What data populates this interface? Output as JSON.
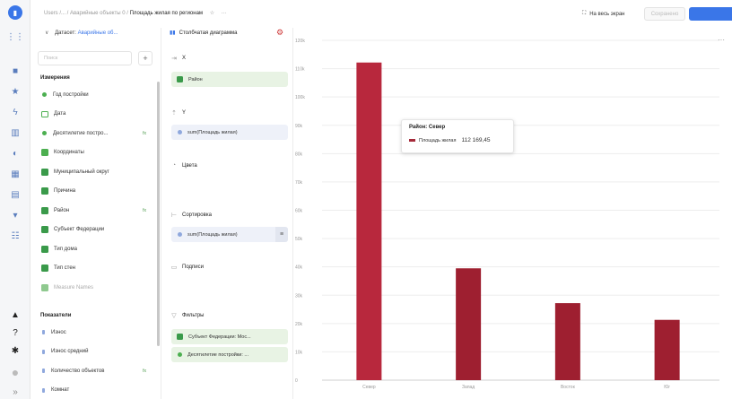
{
  "topbar": {
    "breadcrumb_prefix": "Users /... / Аварийные объекты 0 /",
    "breadcrumb_current": "Площадь жилая по регионам",
    "star": "☆",
    "more": "···",
    "fullscreen_label": "На весь экран",
    "save_label": "Сохранено"
  },
  "dataset": {
    "label": "Датасет:",
    "name": "Аварийные об...",
    "search_placeholder": "Поиск",
    "plus": "+",
    "dimensions_title": "Измерения",
    "dimensions": [
      {
        "label": "Год постройки",
        "kind": "dot",
        "color": "#4caf50",
        "fx": ""
      },
      {
        "label": "Дата",
        "kind": "cal",
        "color": "#4caf50",
        "fx": ""
      },
      {
        "label": "Десятилетие постро...",
        "kind": "dot",
        "color": "#4caf50",
        "fx": "fx"
      },
      {
        "label": "Координаты",
        "kind": "sq",
        "color": "#4caf50",
        "fx": ""
      },
      {
        "label": "Муниципальный округ",
        "kind": "sq",
        "color": "#3a9a4a",
        "fx": ""
      },
      {
        "label": "Причина",
        "kind": "sq",
        "color": "#3a9a4a",
        "fx": ""
      },
      {
        "label": "Район",
        "kind": "sq",
        "color": "#3a9a4a",
        "fx": "fx"
      },
      {
        "label": "Субъект Федерации",
        "kind": "sq",
        "color": "#3a9a4a",
        "fx": ""
      },
      {
        "label": "Тип дома",
        "kind": "sq",
        "color": "#3a9a4a",
        "fx": ""
      },
      {
        "label": "Тип стен",
        "kind": "sq",
        "color": "#3a9a4a",
        "fx": ""
      },
      {
        "label": "Measure Names",
        "kind": "sq",
        "color": "#8fc98f",
        "fx": ""
      }
    ],
    "measures_title": "Показатели",
    "measures": [
      {
        "label": "Износ",
        "color": "#8fa8dd",
        "fx": ""
      },
      {
        "label": "Износ средний",
        "color": "#8fa8dd",
        "fx": ""
      },
      {
        "label": "Количество объектов",
        "color": "#8fa8dd",
        "fx": "fx"
      },
      {
        "label": "Комнат",
        "color": "#8fa8dd",
        "fx": ""
      }
    ]
  },
  "wizard": {
    "viz_label": "Столбчатая диаграмма",
    "x_label": "X",
    "x_chip": "Район",
    "y_label": "Y",
    "y_chip": "sum(Площадь жилая)",
    "colors_label": "Цвета",
    "sort_label": "Сортировка",
    "sort_chip": "sum(Площадь жилая)",
    "labels_label": "Подписи",
    "filters_label": "Фильтры",
    "filter_chips": [
      "Субъект Федерации: Мос...",
      "Десятилетие постройки: ..."
    ]
  },
  "tooltip": {
    "title": "Район: Север",
    "series": "Площадь жилая",
    "value": "112 169,45"
  },
  "chart_data": {
    "type": "bar",
    "categories": [
      "Север",
      "Запад",
      "Восток",
      "Юг"
    ],
    "series": [
      {
        "name": "Площадь жилая",
        "values": [
          112169.45,
          39500,
          27200,
          21300
        ]
      }
    ],
    "ylim": [
      0,
      120000
    ],
    "yticks": [
      "0",
      "10k",
      "20k",
      "30k",
      "40k",
      "50k",
      "60k",
      "70k",
      "80k",
      "90k",
      "100k",
      "110k",
      "120k"
    ],
    "colors": {
      "bar": "#9e1f30",
      "bar_hover": "#b8283d"
    },
    "grid": true
  }
}
